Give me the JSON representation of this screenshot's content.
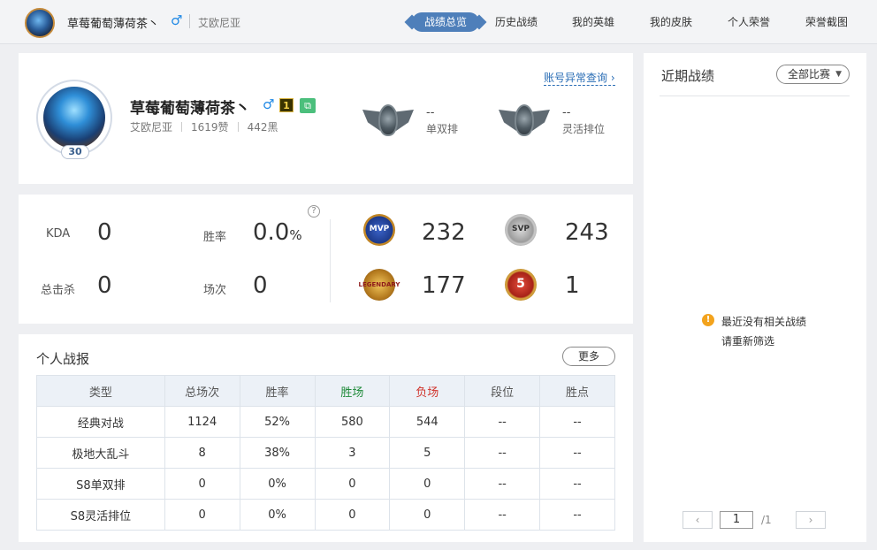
{
  "header": {
    "player_name": "草莓葡萄薄荷茶丶",
    "gender_symbol": "♂",
    "region": "艾欧尼亚",
    "tabs": [
      {
        "label": "战绩总览",
        "active": true
      },
      {
        "label": "历史战绩",
        "active": false
      },
      {
        "label": "我的英雄",
        "active": false
      },
      {
        "label": "我的皮肤",
        "active": false
      },
      {
        "label": "个人荣誉",
        "active": false
      },
      {
        "label": "荣誉截图",
        "active": false
      }
    ]
  },
  "profile": {
    "name": "草莓葡萄薄荷茶丶",
    "gender_symbol": "♂",
    "level": "30",
    "rank_icon_text": "1",
    "copy_icon": "copy-icon",
    "region": "艾欧尼亚",
    "likes": "1619赞",
    "blacks": "442黑",
    "account_check_link": "账号异常查询",
    "ranks": [
      {
        "value": "--",
        "label": "单双排"
      },
      {
        "value": "--",
        "label": "灵活排位"
      }
    ]
  },
  "stats": {
    "kda_label": "KDA",
    "kda_value": "0",
    "winrate_label": "胜率",
    "winrate_value": "0.0",
    "winrate_unit": "%",
    "kills_label": "总击杀",
    "kills_value": "0",
    "games_label": "场次",
    "games_value": "0",
    "help_symbol": "?",
    "badges": [
      {
        "name": "mvp-badge-icon",
        "text": "MVP",
        "count": "232"
      },
      {
        "name": "svp-badge-icon",
        "text": "SVP",
        "count": "243"
      },
      {
        "name": "legendary-badge-icon",
        "text": "LEGENDARY",
        "count": "177"
      },
      {
        "name": "penta-kill-badge-icon",
        "text": "5",
        "count": "1"
      }
    ]
  },
  "report": {
    "title": "个人战报",
    "more_label": "更多",
    "columns": [
      "类型",
      "总场次",
      "胜率",
      "胜场",
      "负场",
      "段位",
      "胜点"
    ],
    "rows": [
      [
        "经典对战",
        "1124",
        "52%",
        "580",
        "544",
        "--",
        "--"
      ],
      [
        "极地大乱斗",
        "8",
        "38%",
        "3",
        "5",
        "--",
        "--"
      ],
      [
        "S8单双排",
        "0",
        "0%",
        "0",
        "0",
        "--",
        "--"
      ],
      [
        "S8灵活排位",
        "0",
        "0%",
        "0",
        "0",
        "--",
        "--"
      ]
    ]
  },
  "recent": {
    "title": "近期战绩",
    "filter_label": "全部比赛",
    "empty_line1": "最近没有相关战绩",
    "empty_line2": "请重新筛选",
    "page_current": "1",
    "page_total": "/1",
    "prev_symbol": "‹",
    "next_symbol": "›"
  },
  "colors": {
    "accent": "#4e7fba",
    "win": "#1f8a3a",
    "loss": "#d0342c",
    "warn": "#f3a31d"
  }
}
